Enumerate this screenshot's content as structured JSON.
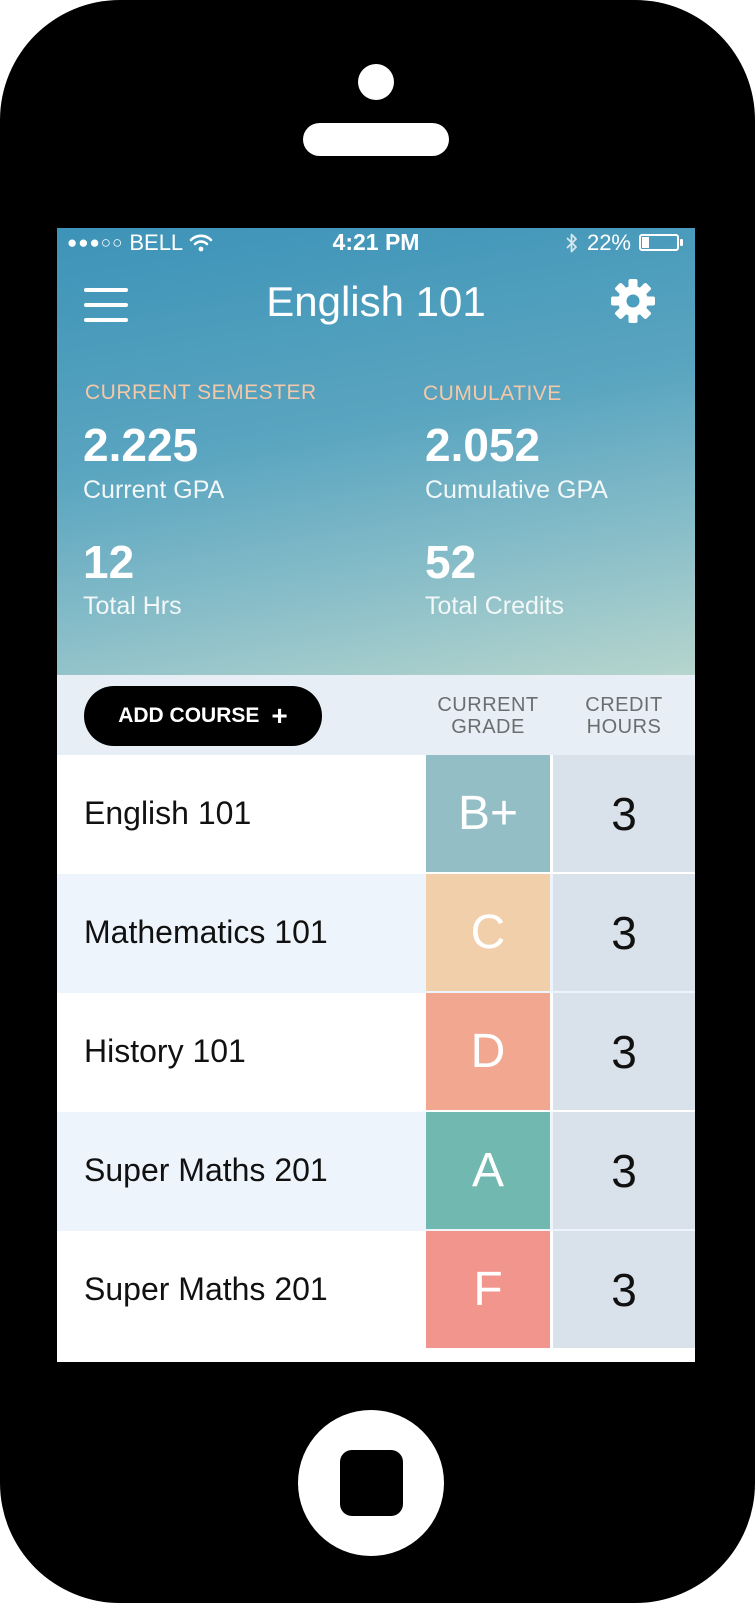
{
  "status_bar": {
    "signal": "●●●○○",
    "carrier": "BELL",
    "time": "4:21 PM",
    "battery": "22%",
    "battery_level": 0.22
  },
  "header": {
    "title": "English 101",
    "menu_icon": "hamburger-menu-icon",
    "settings_icon": "gear-icon"
  },
  "stats": {
    "current_semester_label": "CURRENT SEMESTER",
    "cumulative_label": "CUMULATIVE",
    "current_gpa": "2.225",
    "current_gpa_caption": "Current GPA",
    "cumulative_gpa": "2.052",
    "cumulative_gpa_caption": "Cumulative GPA",
    "total_hrs": "12",
    "total_hrs_caption": "Total Hrs",
    "total_credits": "52",
    "total_credits_caption": "Total Credits"
  },
  "table": {
    "add_course_label": "ADD COURSE",
    "add_icon": "plus-icon",
    "col_grade_line1": "CURRENT",
    "col_grade_line2": "GRADE",
    "col_hours_line1": "CREDIT",
    "col_hours_line2": "HOURS",
    "courses": [
      {
        "name": "English 101",
        "grade": "B+",
        "hours": "3",
        "grade_color": "#93bec5"
      },
      {
        "name": "Mathematics 101",
        "grade": "C",
        "hours": "3",
        "grade_color": "#f2cfab"
      },
      {
        "name": "History 101",
        "grade": "D",
        "hours": "3",
        "grade_color": "#f2a790"
      },
      {
        "name": "Super Maths 201",
        "grade": "A",
        "hours": "3",
        "grade_color": "#71b9b0"
      },
      {
        "name": "Super Maths 201",
        "grade": "F",
        "hours": "3",
        "grade_color": "#f1958d"
      }
    ]
  }
}
